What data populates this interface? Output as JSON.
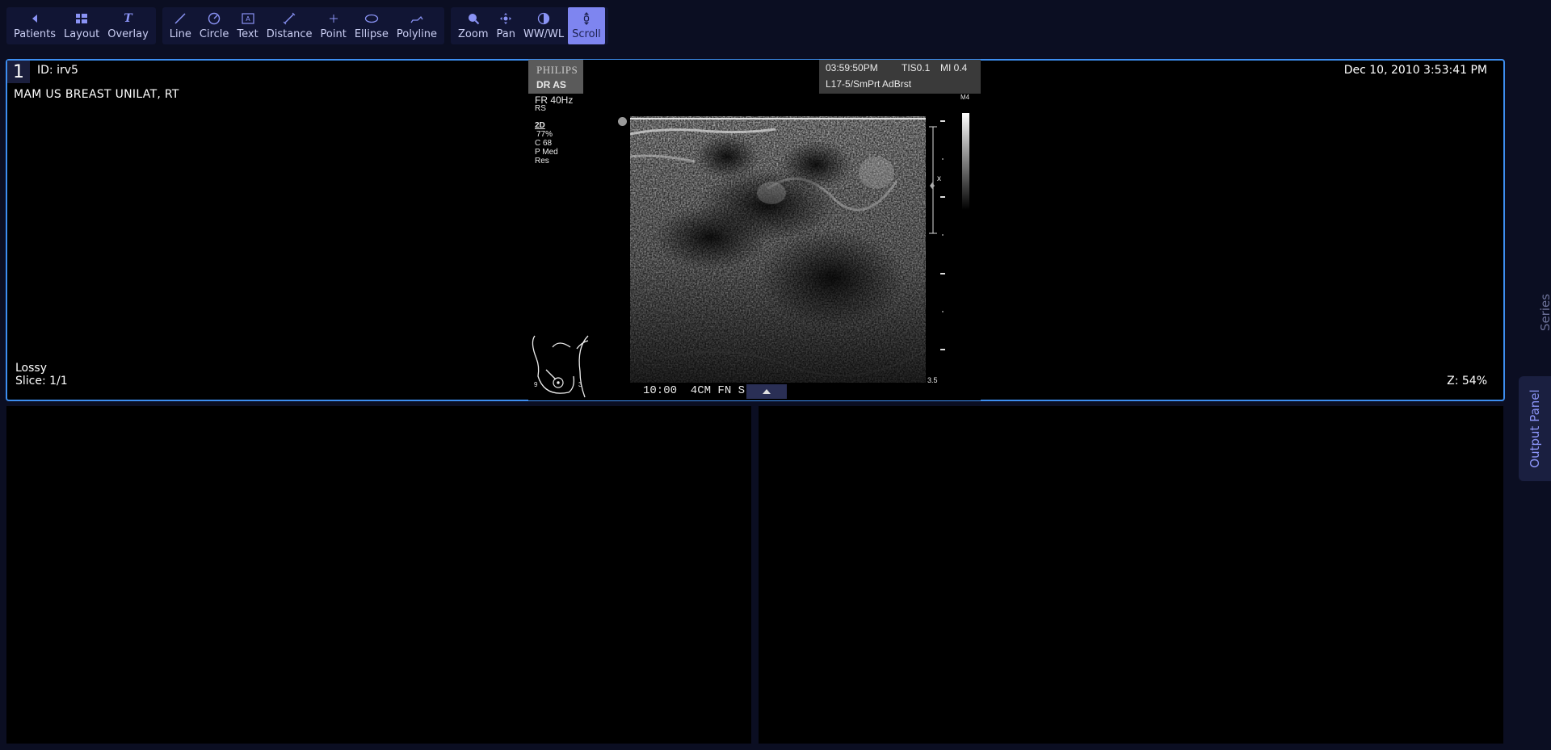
{
  "toolbar": {
    "groups": [
      [
        {
          "label": "Patients",
          "icon": "back-arrow-icon"
        },
        {
          "label": "Layout",
          "icon": "layout-grid-icon"
        },
        {
          "label": "Overlay",
          "icon": "overlay-text-icon"
        }
      ],
      [
        {
          "label": "Line",
          "icon": "line-icon"
        },
        {
          "label": "Circle",
          "icon": "circle-icon"
        },
        {
          "label": "Text",
          "icon": "text-box-icon"
        },
        {
          "label": "Distance",
          "icon": "distance-icon"
        },
        {
          "label": "Point",
          "icon": "point-icon"
        },
        {
          "label": "Ellipse",
          "icon": "ellipse-icon"
        },
        {
          "label": "Polyline",
          "icon": "polyline-icon"
        }
      ],
      [
        {
          "label": "Zoom",
          "icon": "zoom-icon"
        },
        {
          "label": "Pan",
          "icon": "pan-icon"
        },
        {
          "label": "WW/WL",
          "icon": "contrast-icon"
        },
        {
          "label": "Scroll",
          "icon": "scroll-icon",
          "active": true
        }
      ]
    ]
  },
  "viewport1": {
    "number": "1",
    "patient_id": "ID: irv5",
    "study_desc": "MAM US BREAST UNILAT, RT",
    "datetime": "Dec 10, 2010 3:53:41 PM",
    "compression": "Lossy",
    "slice": "Slice: 1/1",
    "zoom": "Z: 54%"
  },
  "ultrasound": {
    "brand": "PHILIPS",
    "mode_label": "DR AS",
    "frame_rate": "FR 40Hz",
    "rs": "RS",
    "params": [
      "2D",
      "77%",
      "C 68",
      "P Med",
      "Res"
    ],
    "time": "03:59:50PM",
    "tis": "TIS0.1",
    "mi": "MI 0.4",
    "probe": "L17-5/SmPrt AdBrst",
    "map": "M4",
    "depth": "3.5",
    "bottom_label": "10:00  4CM FN S",
    "marker_x": "x",
    "body_mark_9": "9",
    "body_mark_3": "3"
  },
  "rail": {
    "series": "Series",
    "output_panel": "Output Panel"
  },
  "colors": {
    "accent": "#7e85f0",
    "viewport_border": "#3d8ef0",
    "background": "#0b0e22"
  }
}
